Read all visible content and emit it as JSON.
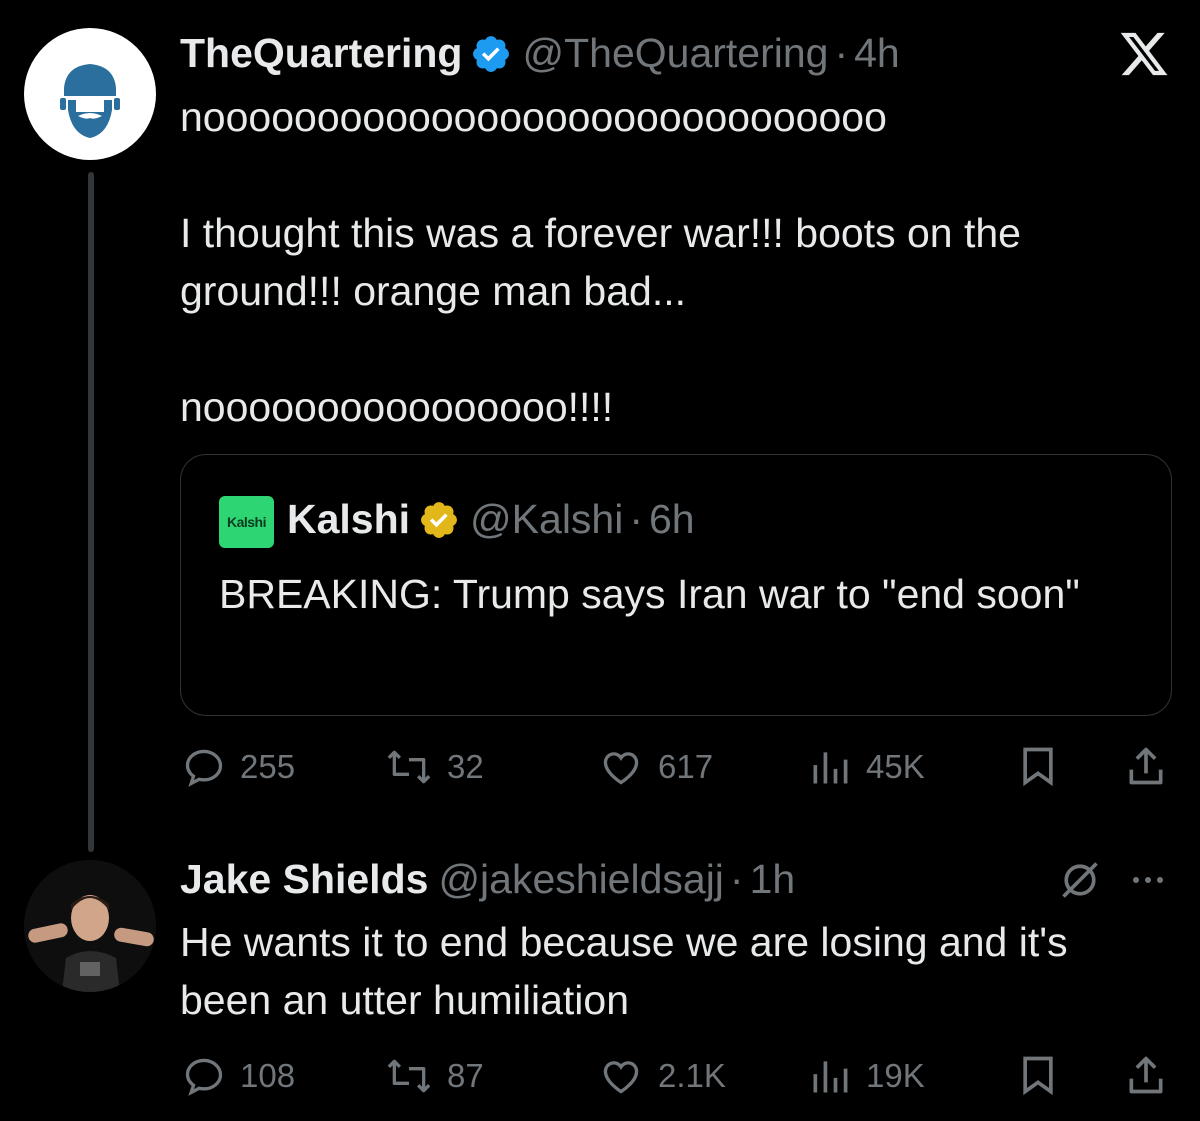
{
  "tweet1": {
    "name": "TheQuartering",
    "handle": "@TheQuartering",
    "separator": "·",
    "time": "4h",
    "text": "noooooooooooooooooooooooooooooo\n\nI thought this was a forever war!!! boots on the ground!!! orange man bad...\n\nnoooooooooooooooo!!!!",
    "verified_color": "#1d9bf0",
    "quote": {
      "logo_text": "Kalshi",
      "name": "Kalshi",
      "handle": "@Kalshi",
      "separator": "·",
      "time": "6h",
      "text": "BREAKING: Trump says Iran war to \"end soon\"",
      "verified_color": "#e2b719"
    },
    "actions": {
      "replies": "255",
      "reposts": "32",
      "likes": "617",
      "views": "45K"
    }
  },
  "tweet2": {
    "name": "Jake Shields",
    "handle": "@jakeshieldsajj",
    "separator": "·",
    "time": "1h",
    "text": "He wants it to end because we are losing and it's been an utter humiliation",
    "actions": {
      "replies": "108",
      "reposts": "87",
      "likes": "2.1K",
      "views": "19K"
    }
  },
  "icons": {
    "app_logo": "x-logo-icon",
    "reply": "reply-icon",
    "repost": "repost-icon",
    "like": "like-icon",
    "views": "views-icon",
    "bookmark": "bookmark-icon",
    "share": "share-icon",
    "grok": "grok-icon",
    "more": "more-icon"
  },
  "colors": {
    "background": "#000000",
    "text": "#e7e9ea",
    "muted": "#71767b",
    "border": "#2f3336",
    "kalshi": "#2ed573"
  }
}
